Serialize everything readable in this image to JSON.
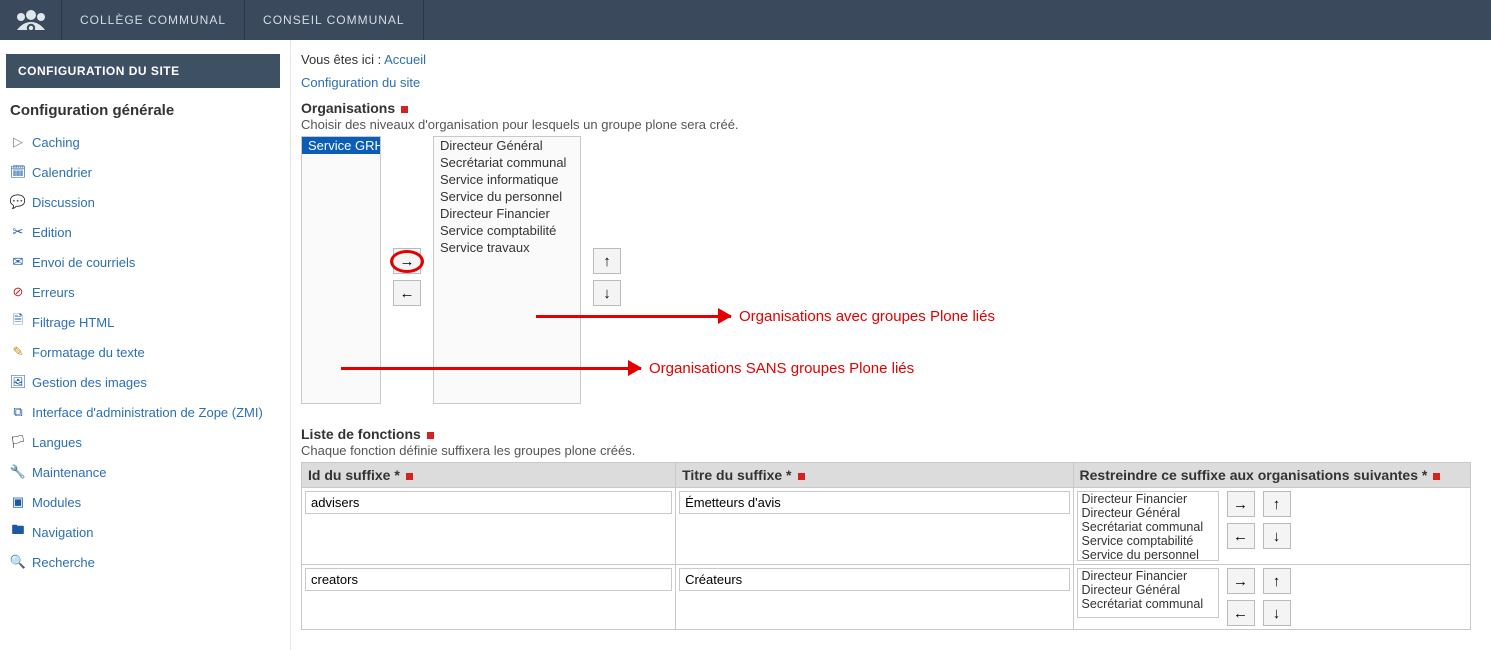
{
  "topnav": {
    "tab1": "COLLÈGE COMMUNAL",
    "tab2": "CONSEIL COMMUNAL"
  },
  "sidebar": {
    "header": "CONFIGURATION DU SITE",
    "section": "Configuration générale",
    "items": [
      {
        "label": "Caching"
      },
      {
        "label": "Calendrier"
      },
      {
        "label": "Discussion"
      },
      {
        "label": "Edition"
      },
      {
        "label": "Envoi de courriels"
      },
      {
        "label": "Erreurs"
      },
      {
        "label": "Filtrage HTML"
      },
      {
        "label": "Formatage du texte"
      },
      {
        "label": "Gestion des images"
      },
      {
        "label": "Interface d'administration de Zope (ZMI)"
      },
      {
        "label": "Langues"
      },
      {
        "label": "Maintenance"
      },
      {
        "label": "Modules"
      },
      {
        "label": "Navigation"
      },
      {
        "label": "Recherche"
      }
    ]
  },
  "breadcrumb": {
    "prefix": "Vous êtes ici : ",
    "home": "Accueil"
  },
  "config_link": "Configuration du site",
  "orgs": {
    "label": "Organisations",
    "help": "Choisir des niveaux d'organisation pour lesquels un groupe plone sera créé.",
    "left_items": [
      "Service GRH"
    ],
    "right_items": [
      "Directeur Général",
      "Secrétariat communal",
      "Service informatique",
      "Service du personnel",
      "Directeur Financier",
      "Service comptabilité",
      "Service travaux"
    ],
    "btn_right": "→",
    "btn_left": "←",
    "btn_up": "↑",
    "btn_down": "↓",
    "anno_with": "Organisations avec groupes Plone liés",
    "anno_without": "Organisations SANS groupes Plone liés"
  },
  "functions": {
    "label": "Liste de fonctions",
    "help": "Chaque fonction définie suffixera les groupes plone créés.",
    "col_id": "Id du suffixe *",
    "col_title": "Titre du suffixe *",
    "col_restrict": "Restreindre ce suffixe aux organisations suivantes *",
    "rows": [
      {
        "id": "advisers",
        "title": "Émetteurs d'avis",
        "orgs": [
          "Directeur Financier",
          "Directeur Général",
          "Secrétariat communal",
          "Service comptabilité",
          "Service du personnel"
        ]
      },
      {
        "id": "creators",
        "title": "Créateurs",
        "orgs": [
          "Directeur Financier",
          "Directeur Général",
          "Secrétariat communal"
        ]
      }
    ],
    "btn_right": "→",
    "btn_left": "←",
    "btn_up": "↑",
    "btn_down": "↓"
  }
}
